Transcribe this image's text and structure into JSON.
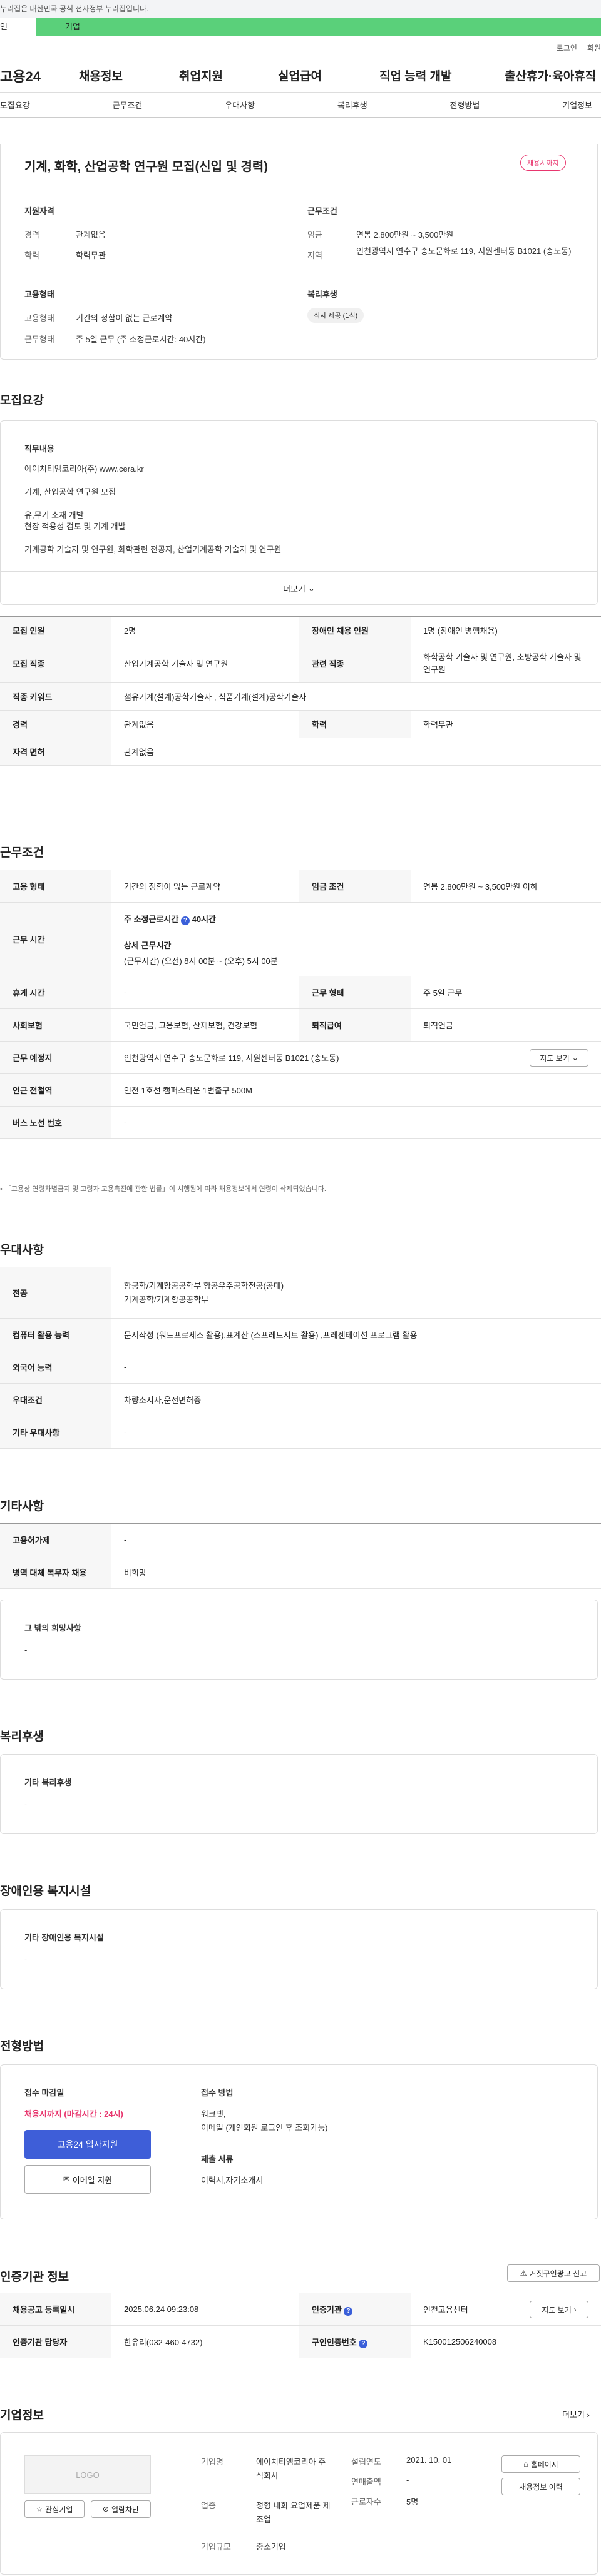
{
  "gov_notice": "누리집은 대한민국 공식 전자정부 누리집입니다.",
  "seg": {
    "personal": "인",
    "corp": "기업"
  },
  "util": {
    "login": "로그인",
    "join": "회원"
  },
  "gnb": {
    "logo": "고용24",
    "menu": [
      "채용정보",
      "취업지원",
      "실업급여",
      "직업 능력 개발",
      "출산휴가·육아휴직"
    ]
  },
  "tabs": [
    "모집요강",
    "근무조건",
    "우대사항",
    "복리후생",
    "전형방법",
    "기업정보"
  ],
  "summary": {
    "title": "기계, 화학, 산업공학 연구원 모집(신입 및 경력)",
    "badge": "채용시까지",
    "qual_h": "지원자격",
    "career_k": "경력",
    "career_v": "관계없음",
    "edu_k": "학력",
    "edu_v": "학력무관",
    "cond_h": "근무조건",
    "wage_k": "임금",
    "wage_v": "연봉 2,800만원 ~ 3,500만원",
    "loc_k": "지역",
    "loc_v": "인천광역시 연수구 송도문화로 119, 지원센터동 B1021 (송도동)",
    "emp_h": "고용형태",
    "emptype_k": "고용형태",
    "emptype_v": "기간의 정함이 없는 근로계약",
    "worktype_k": "근무형태",
    "worktype_v": "주 5일 근무 (주 소정근로시간: 40시간)",
    "wel_h": "복리후생",
    "wel_v": "식사 제공 (1식)"
  },
  "req": {
    "h": "모집요강",
    "job_h": "직무내용",
    "lines": [
      "에이치티엠코리아(주) www.cera.kr",
      "기계, 산업공학 연구원 모집",
      "유,무기 소재 개발",
      "현장 적용성 검토 및 기계 개발",
      "기계공학 기술자 및 연구원, 화학관련 전공자, 산업기계공학 기술자 및 연구원"
    ],
    "more": "더보기"
  },
  "t1": {
    "rows": [
      [
        "모집 인원",
        "2명",
        "장애인 채용 인원",
        "1명 (장애인 병행채용)"
      ],
      [
        "모집 직종",
        "산업기계공학 기술자 및 연구원",
        "관련 직종",
        "화학공학 기술자 및 연구원, 소방공학 기술자 및 연구원"
      ],
      [
        "직종 키워드",
        "섬유기계(설계)공학기술자 , 식품기계(설계)공학기술자",
        "",
        ""
      ],
      [
        "경력",
        "관계없음",
        "학력",
        "학력무관"
      ],
      [
        "자격 면허",
        "관계없음",
        "",
        ""
      ]
    ]
  },
  "cond": {
    "h": "근무조건",
    "emp_k": "고용 형태",
    "emp_v": "기간의 정함이 없는 근로계약",
    "wage_k": "임금 조건",
    "wage_v": "연봉 2,800만원 ~ 3,500만원 이하",
    "time_k": "근무 시간",
    "week": "주 소정근로시간",
    "week_v": "40시간",
    "detail_h": "상세 근무시간",
    "detail_v": "(근무시간) (오전) 8시 00분 ~ (오후) 5시 00분",
    "off_k": "휴게 시간",
    "off_v": "-",
    "form_k": "근무 형태",
    "form_v": "주 5일 근무",
    "ins_k": "사회보험",
    "ins_v": "국민연금, 고용보험, 산재보험, 건강보험",
    "ret_k": "퇴직급여",
    "ret_v": "퇴직연금",
    "place_k": "근무 예정지",
    "place_v": "인천광역시 연수구 송도문화로 119, 지원센터동 B1021 (송도동)",
    "map": "지도 보기",
    "sub_k": "인근 전철역",
    "sub_v": "인천 1호선 캠퍼스타운 1번출구 500M",
    "bus_k": "버스 노선 번호",
    "bus_v": "-",
    "note": "「고용상 연령차별금지 및 고령자 고용촉진에 관한 법률」이 시행됨에 따라 채용정보에서 연령이 삭제되었습니다."
  },
  "pref": {
    "h": "우대사항",
    "rows": [
      [
        "전공",
        "항공학/기계항공공학부 항공우주공학전공(공대)\n기계공학/기계항공공학부"
      ],
      [
        "컴퓨터 활용 능력",
        "문서작성 (워드프로세스 활용),표계산 (스프레드시트 활용) ,프레젠테이션 프로그램 활용"
      ],
      [
        "외국어 능력",
        "-"
      ],
      [
        "우대조건",
        "차량소지자,운전면허증"
      ],
      [
        "기타 우대사항",
        "-"
      ]
    ]
  },
  "etc": {
    "h": "기타사항",
    "rows": [
      [
        "고용허가제",
        "-"
      ],
      [
        "병역 대체 복무자 채용",
        "비희망"
      ]
    ],
    "box_h": "그 밖의 희망사항",
    "box_v": "-"
  },
  "wel": {
    "h": "복리후생",
    "box_h": "기타 복리후생",
    "box_v": "-"
  },
  "dis": {
    "h": "장애인용 복지시설",
    "box_h": "기타 장애인용 복지시설",
    "box_v": "-"
  },
  "proc": {
    "h": "전형방법",
    "dl_h": "접수 마감일",
    "dl_v": "채용시까지 (마감시간 : 24시)",
    "apply": "고용24 입사지원",
    "email": "이메일 지원",
    "how_h": "접수 방법",
    "how_v": "워크넷,\n이메일 (개인회원 로그인 후 조회가능)",
    "doc_h": "제출 서류",
    "doc_v": "이력서,자기소개서"
  },
  "cert": {
    "h": "인증기관 정보",
    "report": "거짓구인광고 신고",
    "rows": [
      [
        "채용공고 등록일시",
        "2025.06.24 09:23:08",
        "인증기관",
        "인천고용센터"
      ],
      [
        "인증기관 담당자",
        "한유리(032-460-4732)",
        "구인인증번호",
        "K150012506240008"
      ]
    ],
    "map": "지도 보기"
  },
  "corp": {
    "h": "기업정보",
    "more": "더보기",
    "logo": "LOGO",
    "fav": "관심기업",
    "block": "열람차단",
    "name_k": "기업명",
    "name_v": "에이치티엠코리아 주식회사",
    "ind_k": "업종",
    "ind_v": "정형 내화 요업제품 제조업",
    "size_k": "기업규모",
    "size_v": "중소기업",
    "est_k": "설립연도",
    "est_v": "2021. 10. 01",
    "sales_k": "연매출액",
    "sales_v": "-",
    "emp_k": "근로자수",
    "emp_v": "5명",
    "home": "홈페이지",
    "list": "채용정보 이력"
  }
}
